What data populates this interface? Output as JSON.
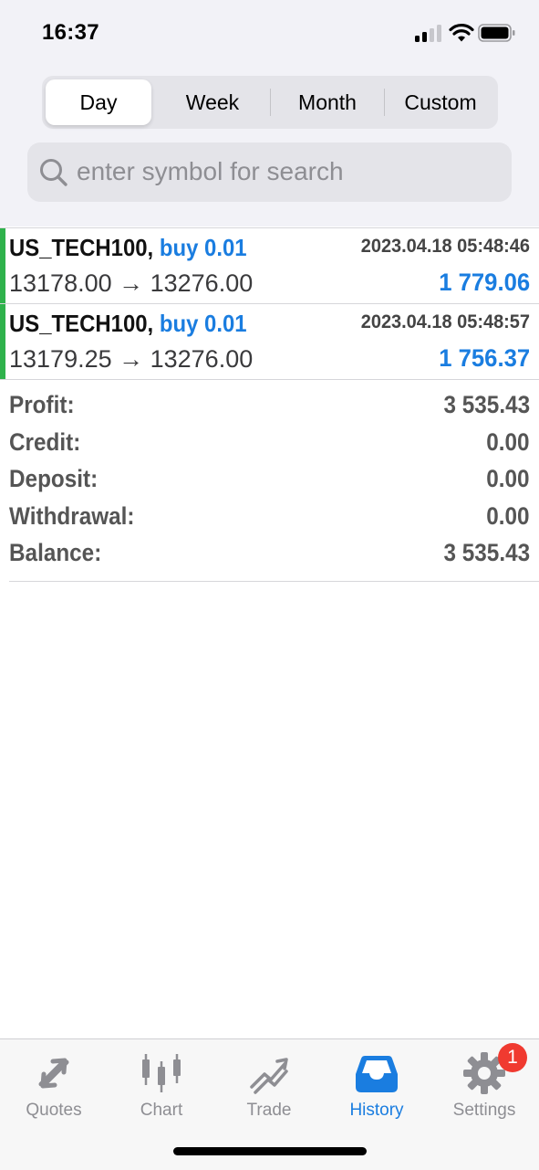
{
  "status_bar": {
    "time": "16:37"
  },
  "periods": [
    {
      "label": "Day",
      "selected": true
    },
    {
      "label": "Week",
      "selected": false
    },
    {
      "label": "Month",
      "selected": false
    },
    {
      "label": "Custom",
      "selected": false
    }
  ],
  "search": {
    "placeholder": "enter symbol for search",
    "value": ""
  },
  "deals": [
    {
      "symbol": "US_TECH100,",
      "side": "buy 0.01",
      "time": "2023.04.18 05:48:46",
      "prices": "13178.00 → 13276.00",
      "profit": "1 779.06"
    },
    {
      "symbol": "US_TECH100,",
      "side": "buy 0.01",
      "time": "2023.04.18 05:48:57",
      "prices": "13179.25 → 13276.00",
      "profit": "1 756.37"
    }
  ],
  "summary": [
    {
      "label": "Profit:",
      "value": "3 535.43"
    },
    {
      "label": "Credit:",
      "value": "0.00"
    },
    {
      "label": "Deposit:",
      "value": "0.00"
    },
    {
      "label": "Withdrawal:",
      "value": "0.00"
    },
    {
      "label": "Balance:",
      "value": "3 535.43"
    }
  ],
  "tabs": [
    {
      "label": "Quotes",
      "icon": "quotes-icon"
    },
    {
      "label": "Chart",
      "icon": "chart-icon"
    },
    {
      "label": "Trade",
      "icon": "trade-icon"
    },
    {
      "label": "History",
      "icon": "history-icon",
      "active": true
    },
    {
      "label": "Settings",
      "icon": "settings-icon",
      "badge": "1"
    }
  ],
  "colors": {
    "accent": "#1a7de0",
    "buy_bar": "#2fb24c",
    "badge": "#f03a30",
    "inactive_tab": "#8e8e93"
  }
}
